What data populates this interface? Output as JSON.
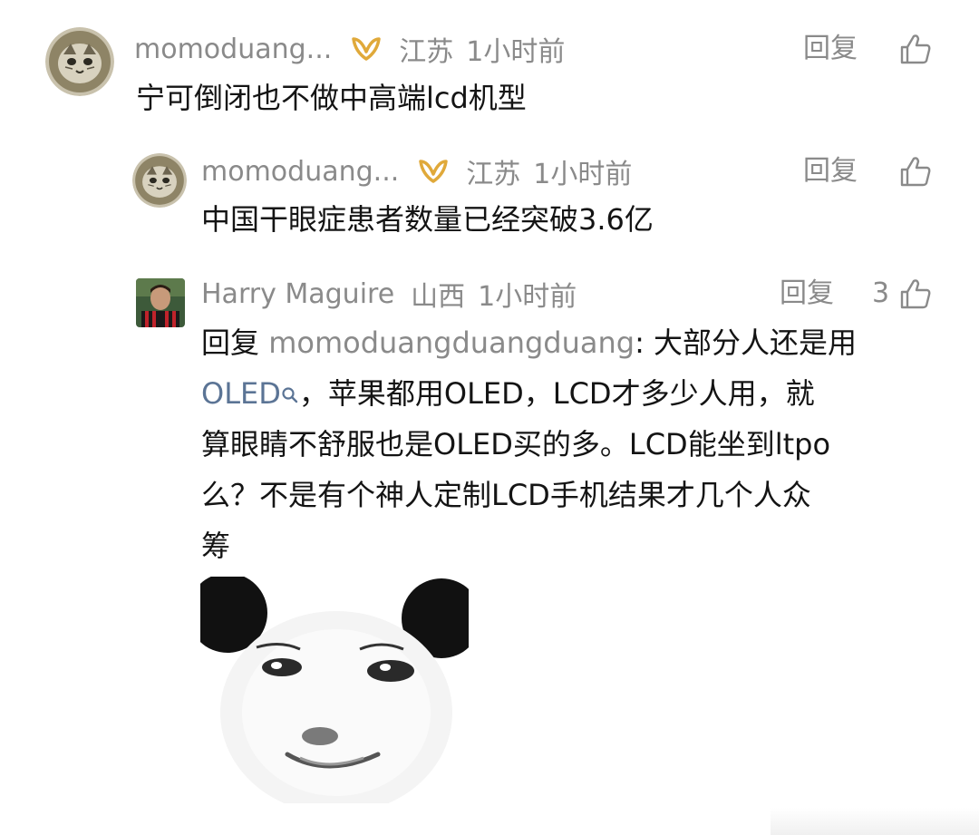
{
  "comments": [
    {
      "username": "momoduang...",
      "location": "江苏",
      "time": "1小时前",
      "reply_label": "回复",
      "text": "宁可倒闭也不做中高端lcd机型"
    },
    {
      "username": "momoduang...",
      "location": "江苏",
      "time": "1小时前",
      "reply_label": "回复",
      "text": "中国干眼症患者数量已经突破3.6亿"
    },
    {
      "username": "Harry Maguire",
      "location": "山西",
      "time": "1小时前",
      "reply_label": "回复",
      "like_count": "3",
      "text_prefix": "回复 ",
      "mention": "momoduangduangduang",
      "text_after_mention": ": 大部分人还是用",
      "topic": "OLED",
      "text_rest_line2": "，苹果都用OLED，LCD才多少人用，就",
      "text_line3": "算眼睛不舒服也是OLED买的多。LCD能坐到ltpo",
      "text_line4": "么？不是有个神人定制LCD手机结果才几个人众",
      "text_line5": "筹"
    }
  ],
  "icons": {
    "vip_badge": "vip-badge-icon",
    "like": "thumbs-up-icon",
    "search": "search-icon"
  },
  "colors": {
    "meta_gray": "#8a8a8a",
    "link_blue": "#5b7495",
    "vip_gold": "#e0a93a",
    "text": "#141414"
  }
}
